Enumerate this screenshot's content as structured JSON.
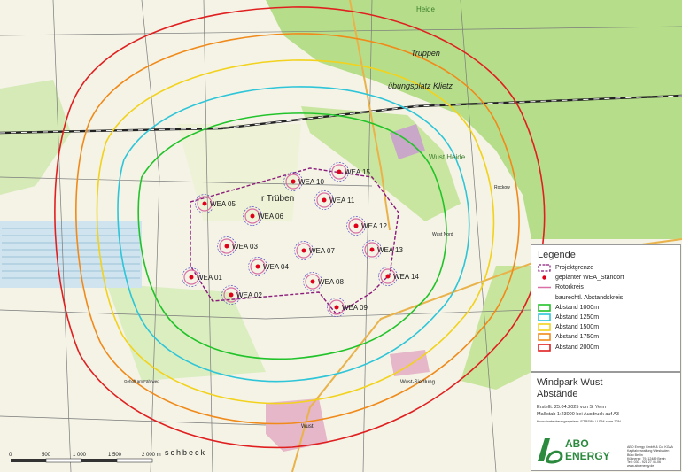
{
  "map": {
    "place_labels": {
      "heide_top": "Heide",
      "truppen": "Truppen",
      "uebungsplatz": "übungsplatz Klietz",
      "wust_heide": "Wust Heide",
      "trueben": "r Trüben",
      "wust_siedlung": "Wust-Siedlung",
      "wust": "Wust",
      "wust_road": "Wust Nord",
      "schbeck": "schbeck",
      "rockow": "Rockow",
      "gehoeft": "Gehöft am Fährweg"
    },
    "turbines": [
      {
        "id": "WEA 01"
      },
      {
        "id": "WEA 02"
      },
      {
        "id": "WEA 03"
      },
      {
        "id": "WEA 04"
      },
      {
        "id": "WEA 05"
      },
      {
        "id": "WEA 06"
      },
      {
        "id": "WEA 07"
      },
      {
        "id": "WEA 08"
      },
      {
        "id": "WEA 09"
      },
      {
        "id": "WEA 10"
      },
      {
        "id": "WEA 11"
      },
      {
        "id": "WEA 12"
      },
      {
        "id": "WEA 13"
      },
      {
        "id": "WEA 14"
      },
      {
        "id": "WEA 15"
      }
    ],
    "scalebar": {
      "ticks": [
        "0",
        "500",
        "1 000",
        "1 500",
        "2 000 m"
      ]
    }
  },
  "legend": {
    "title": "Legende",
    "items": [
      {
        "label": "Projektgrenze",
        "symbol": "dashed-box",
        "color": "#8b1a7a"
      },
      {
        "label": "geplanter WEA_Standort",
        "symbol": "red-dot",
        "color": "#e0001a"
      },
      {
        "label": "Rotorkreis",
        "symbol": "line",
        "color": "#d96fa4"
      },
      {
        "label": "baurechtl. Abstandskreis",
        "symbol": "dashed-line",
        "color": "#5a4fc9"
      },
      {
        "label": "Abstand 1000m",
        "symbol": "box",
        "color": "#22c32a"
      },
      {
        "label": "Abstand 1250m",
        "symbol": "box",
        "color": "#2ec5d8"
      },
      {
        "label": "Abstand 1500m",
        "symbol": "box",
        "color": "#f2d21c"
      },
      {
        "label": "Abstand 1750m",
        "symbol": "box",
        "color": "#f08a1a"
      },
      {
        "label": "Abstand 2000m",
        "symbol": "box",
        "color": "#e02020"
      }
    ]
  },
  "titlebox": {
    "title": "Windpark Wust",
    "subtitle": "Abstände",
    "created": "Erstellt: 25.04.2025 von S. Yeim",
    "scale": "Maßstab 1:23000  bei Ausdruck auf A3",
    "crs": "Koordinatenbezugssystem: ETRS89 / UTM zone 32N",
    "logo_top": "ABO",
    "logo_bottom": "ENERGY",
    "company": [
      "ABO Energy GmbH & Co. KGaA",
      "Kapitalverwaltung Wiesbaden",
      "Büro Berlin",
      "Kühnerstr. 79, 12489 Berlin",
      "Tel.: 030 - 921 27 46-06",
      "www.aboenergy.de"
    ]
  }
}
